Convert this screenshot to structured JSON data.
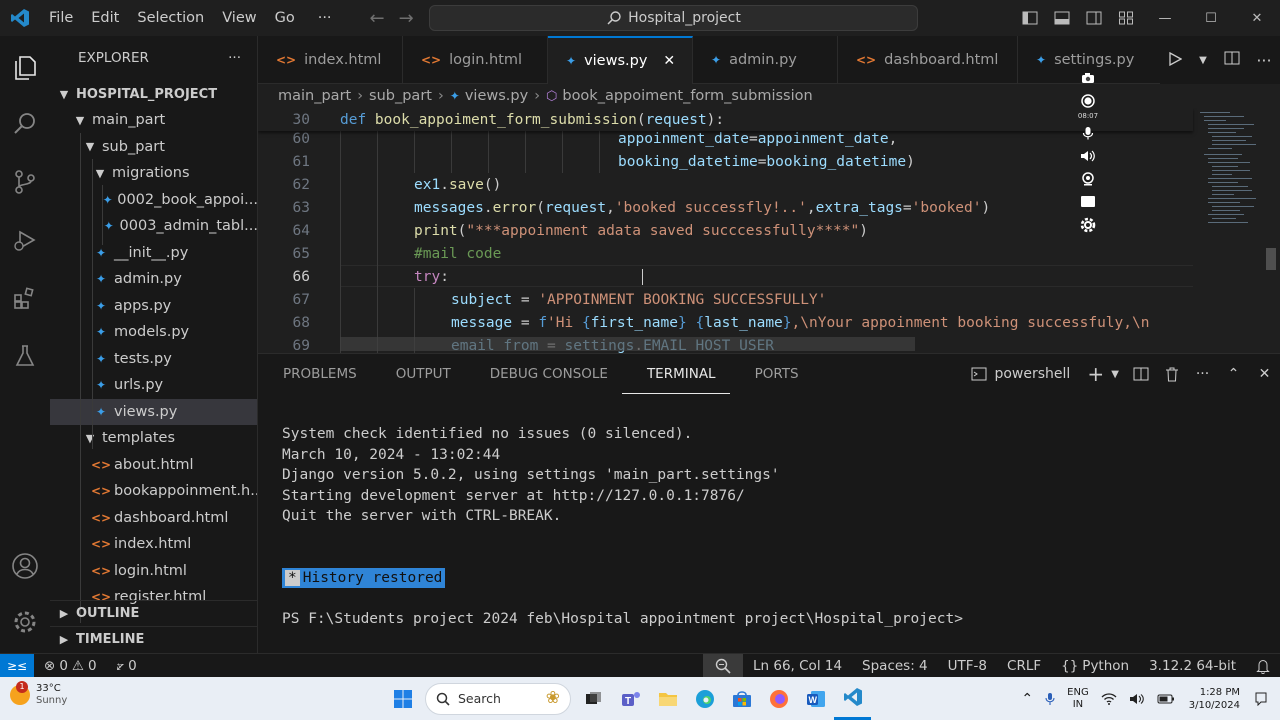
{
  "titlebar": {
    "menu": [
      "File",
      "Edit",
      "Selection",
      "View",
      "Go"
    ],
    "more": "···",
    "search": "Hospital_project",
    "window": {
      "minimize": "—",
      "maximize": "☐",
      "close": "✕"
    }
  },
  "explorer": {
    "title": "EXPLORER",
    "more": "···",
    "project": "HOSPITAL_PROJECT",
    "items": [
      {
        "label": "main_part",
        "type": "folder",
        "depth": 1
      },
      {
        "label": "sub_part",
        "type": "folder",
        "depth": 2
      },
      {
        "label": "migrations",
        "type": "folder",
        "depth": 3
      },
      {
        "label": "0002_book_appoi...",
        "type": "py",
        "depth": 4
      },
      {
        "label": "0003_admin_tabl...",
        "type": "py",
        "depth": 4
      },
      {
        "label": "__init__.py",
        "type": "py",
        "depth": 3
      },
      {
        "label": "admin.py",
        "type": "py",
        "depth": 3
      },
      {
        "label": "apps.py",
        "type": "py",
        "depth": 3
      },
      {
        "label": "models.py",
        "type": "py",
        "depth": 3
      },
      {
        "label": "tests.py",
        "type": "py",
        "depth": 3
      },
      {
        "label": "urls.py",
        "type": "py",
        "depth": 3
      },
      {
        "label": "views.py",
        "type": "py",
        "depth": 3,
        "active": true
      },
      {
        "label": "templates",
        "type": "folder",
        "depth": 2
      },
      {
        "label": "about.html",
        "type": "html",
        "depth": 3
      },
      {
        "label": "bookappoinment.h...",
        "type": "html",
        "depth": 3
      },
      {
        "label": "dashboard.html",
        "type": "html",
        "depth": 3
      },
      {
        "label": "index.html",
        "type": "html",
        "depth": 3
      },
      {
        "label": "login.html",
        "type": "html",
        "depth": 3
      },
      {
        "label": "register.html",
        "type": "html",
        "depth": 3
      }
    ],
    "outline": "OUTLINE",
    "timeline": "TIMELINE"
  },
  "tabs": [
    {
      "label": "index.html",
      "type": "html"
    },
    {
      "label": "login.html",
      "type": "html"
    },
    {
      "label": "views.py",
      "type": "py",
      "active": true
    },
    {
      "label": "admin.py",
      "type": "py"
    },
    {
      "label": "dashboard.html",
      "type": "html"
    },
    {
      "label": "settings.py",
      "type": "py"
    }
  ],
  "breadcrumb": [
    "main_part",
    "sub_part",
    "views.py",
    "book_appoiment_form_submission"
  ],
  "code": [
    {
      "ln": "30",
      "sticky": true,
      "tokens": [
        [
          "kw",
          "def "
        ],
        [
          "fn",
          "book_appoiment_form_submission"
        ],
        [
          "pl",
          "("
        ],
        [
          "var",
          "request"
        ],
        [
          "pl",
          "):"
        ]
      ]
    },
    {
      "ln": "60",
      "indent": 278,
      "tokens": [
        [
          "var",
          "appoinment_date"
        ],
        [
          "pl",
          "="
        ],
        [
          "var",
          "appoinment_date"
        ],
        [
          "pl",
          ","
        ]
      ]
    },
    {
      "ln": "61",
      "indent": 278,
      "tokens": [
        [
          "var",
          "booking_datetime"
        ],
        [
          "pl",
          "="
        ],
        [
          "var",
          "booking_datetime"
        ],
        [
          "pl",
          ")"
        ]
      ]
    },
    {
      "ln": "62",
      "indent": 74,
      "tokens": [
        [
          "var",
          "ex1"
        ],
        [
          "pl",
          "."
        ],
        [
          "fn",
          "save"
        ],
        [
          "pl",
          "()"
        ]
      ]
    },
    {
      "ln": "63",
      "indent": 74,
      "tokens": [
        [
          "var",
          "messages"
        ],
        [
          "pl",
          "."
        ],
        [
          "fn",
          "error"
        ],
        [
          "pl",
          "("
        ],
        [
          "var",
          "request"
        ],
        [
          "pl",
          ","
        ],
        [
          "str",
          "'booked successfly!..'"
        ],
        [
          "pl",
          ","
        ],
        [
          "var",
          "extra_tags"
        ],
        [
          "pl",
          "="
        ],
        [
          "str",
          "'booked'"
        ],
        [
          "pl",
          ")"
        ]
      ]
    },
    {
      "ln": "64",
      "indent": 74,
      "tokens": [
        [
          "fn",
          "print"
        ],
        [
          "pl",
          "("
        ],
        [
          "str",
          "\"***appoinment adata saved succcessfully****\""
        ],
        [
          "pl",
          ")"
        ]
      ]
    },
    {
      "ln": "65",
      "indent": 74,
      "tokens": [
        [
          "cmt",
          "#mail code"
        ]
      ]
    },
    {
      "ln": "66",
      "indent": 74,
      "current": true,
      "tokens": [
        [
          "kw2",
          "try"
        ],
        [
          "pl",
          ":"
        ]
      ]
    },
    {
      "ln": "67",
      "indent": 111,
      "tokens": [
        [
          "var",
          "subject"
        ],
        [
          "pl",
          " = "
        ],
        [
          "str",
          "'APPOINMENT BOOKING SUCCESSFULLY'"
        ]
      ]
    },
    {
      "ln": "68",
      "indent": 111,
      "tokens": [
        [
          "var",
          "message"
        ],
        [
          "pl",
          " = "
        ],
        [
          "kw",
          "f"
        ],
        [
          "str",
          "'Hi "
        ],
        [
          "kw",
          "{"
        ],
        [
          "var",
          "first_name"
        ],
        [
          "kw",
          "}"
        ],
        [
          "str",
          " "
        ],
        [
          "kw",
          "{"
        ],
        [
          "var",
          "last_name"
        ],
        [
          "kw",
          "}"
        ],
        [
          "str",
          ",\\nYour appoinment booking successfuly,\\n"
        ]
      ]
    },
    {
      "ln": "69",
      "indent": 111,
      "tokens": [
        [
          "var",
          "email_from"
        ],
        [
          "pl",
          " = "
        ],
        [
          "var",
          "settings"
        ],
        [
          "pl",
          "."
        ],
        [
          "var",
          "EMAIL_HOST_USER"
        ]
      ]
    }
  ],
  "recorder": {
    "time": "08:07"
  },
  "panel": {
    "tabs": [
      "PROBLEMS",
      "OUTPUT",
      "DEBUG CONSOLE",
      "TERMINAL",
      "PORTS"
    ],
    "active": "TERMINAL",
    "shell": "powershell",
    "terminal": [
      "System check identified no issues (0 silenced).",
      "March 10, 2024 - 13:02:44",
      "Django version 5.0.2, using settings 'main_part.settings'",
      "Starting development server at http://127.0.0.1:7876/",
      "Quit the server with CTRL-BREAK.",
      "",
      "",
      "__HISTORY__",
      "",
      "PS F:\\Students project 2024 feb\\Hospital appointment project\\Hospital_project>"
    ],
    "history_star": "*",
    "history_label": "History restored"
  },
  "status": {
    "errors": "0",
    "warnings": "0",
    "ports": "0",
    "position": "Ln 66, Col 14",
    "spaces": "Spaces: 4",
    "encoding": "UTF-8",
    "eol": "CRLF",
    "language": "Python",
    "interpreter": "3.12.2 64-bit"
  },
  "taskbar": {
    "temp": "33°C",
    "weather": "Sunny",
    "weather_badge": "1",
    "search": "Search",
    "lang1": "ENG",
    "lang2": "IN",
    "time": "1:28 PM",
    "date": "3/10/2024"
  },
  "colors": {
    "accent": "#0078d4",
    "python": "#3b9ee8",
    "html": "#e37933"
  }
}
